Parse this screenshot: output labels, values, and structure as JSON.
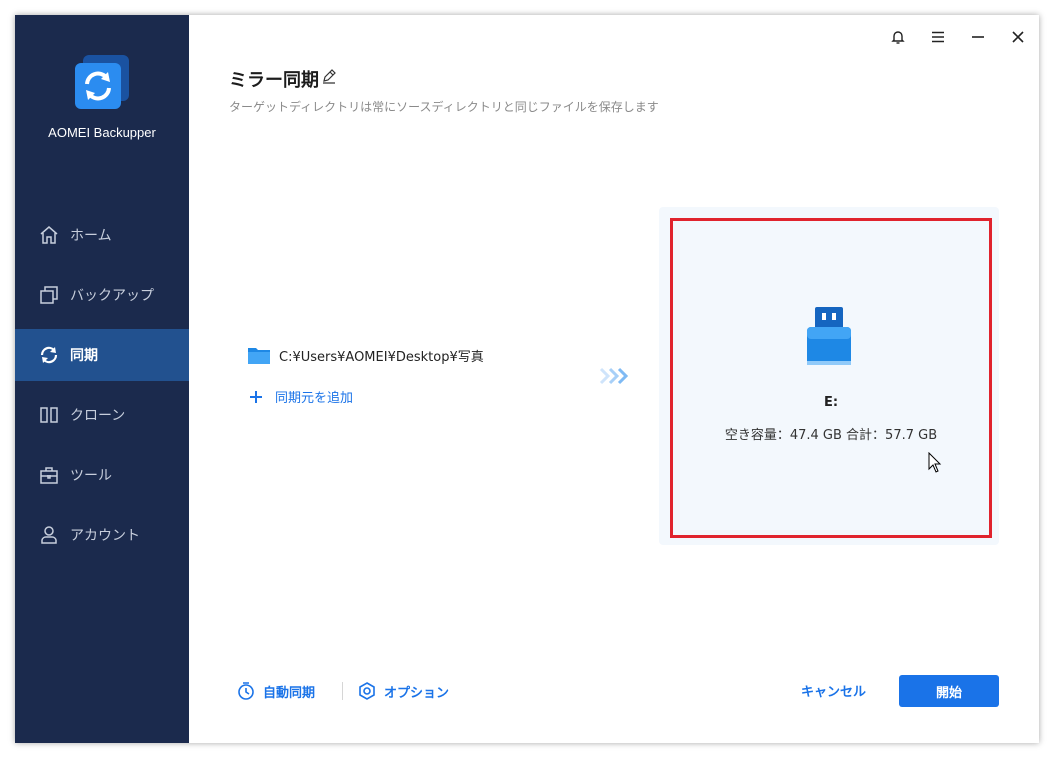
{
  "app": {
    "name": "AOMEI Backupper"
  },
  "sidebar": {
    "items": [
      {
        "label": "ホーム",
        "icon": "home-icon",
        "active": false
      },
      {
        "label": "バックアップ",
        "icon": "backup-icon",
        "active": false
      },
      {
        "label": "同期",
        "icon": "sync-icon",
        "active": true
      },
      {
        "label": "クローン",
        "icon": "clone-icon",
        "active": false
      },
      {
        "label": "ツール",
        "icon": "tools-icon",
        "active": false
      },
      {
        "label": "アカウント",
        "icon": "account-icon",
        "active": false
      }
    ]
  },
  "titlebar": {
    "icons": [
      "bell-icon",
      "menu-icon",
      "minimize-icon",
      "close-icon"
    ]
  },
  "main": {
    "title": "ミラー同期",
    "subtitle": "ターゲットディレクトリは常にソースディレクトリと同じファイルを保存します",
    "source_path": "C:¥Users¥AOMEI¥Desktop¥写真",
    "add_source_label": "同期元を追加"
  },
  "target": {
    "drive_label": "E:",
    "space_text": "空き容量：47.4 GB 合計：57.7 GB"
  },
  "footer": {
    "auto_sync_label": "自動同期",
    "options_label": "オプション",
    "cancel_label": "キャンセル",
    "start_label": "開始"
  },
  "colors": {
    "sidebar_bg": "#1b2a4d",
    "sidebar_active": "#22518f",
    "accent": "#1a73e8",
    "highlight_border": "#e0232d"
  }
}
